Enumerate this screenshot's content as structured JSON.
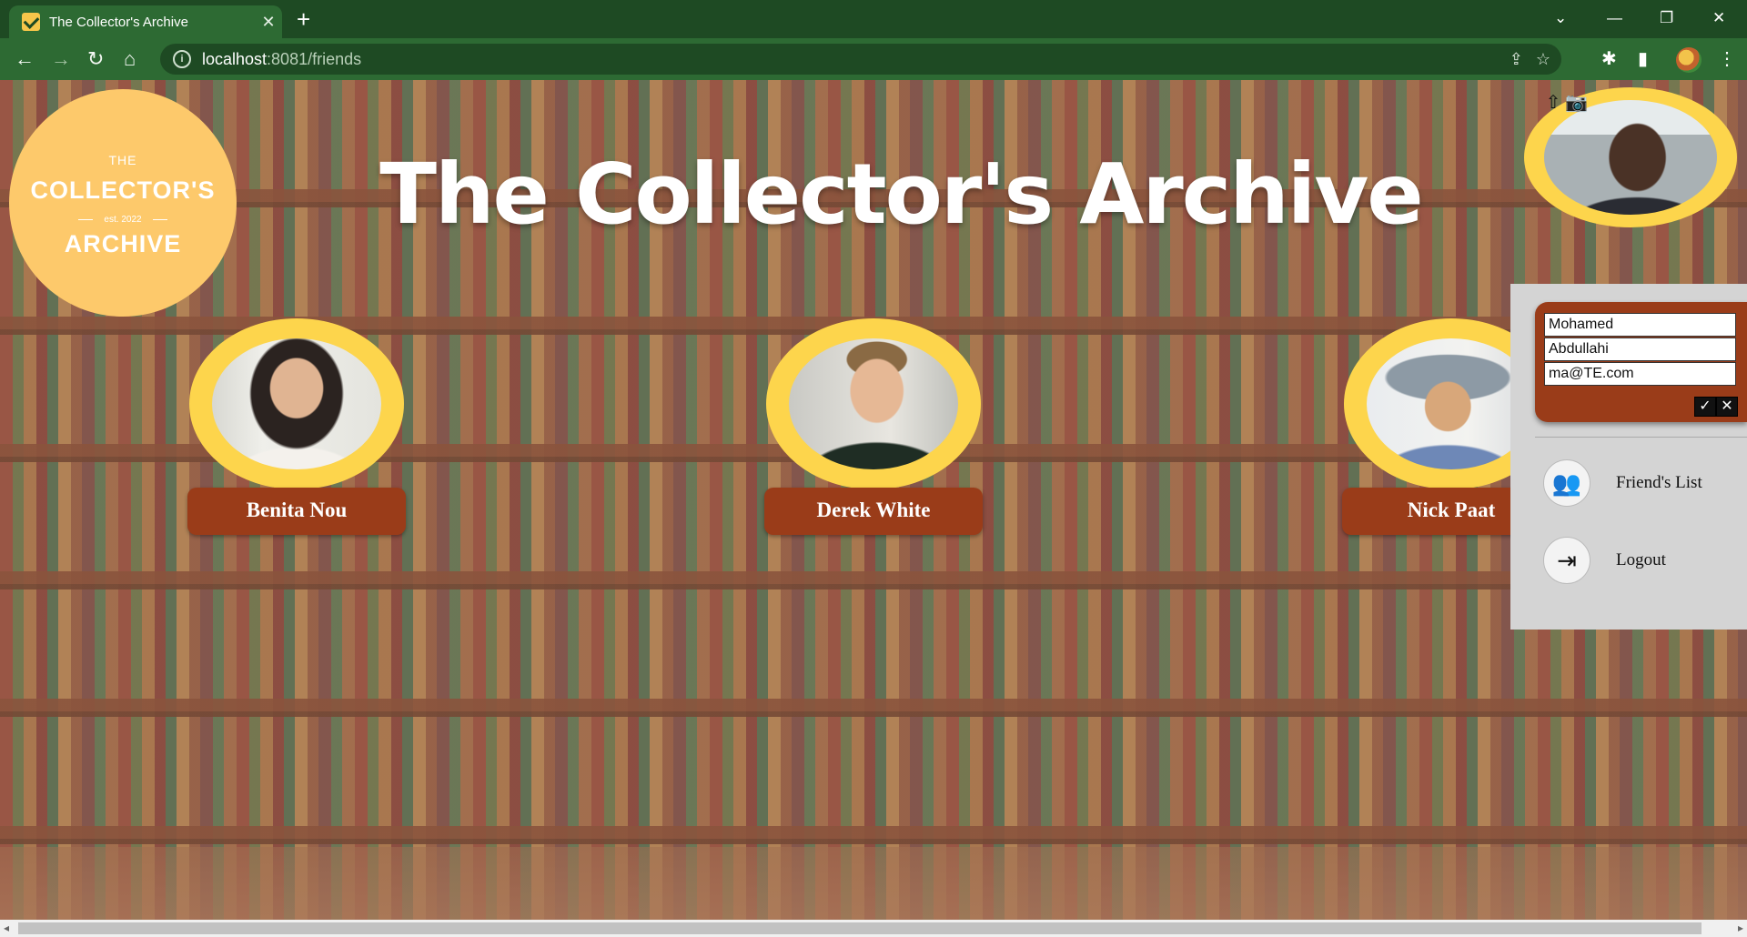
{
  "browser": {
    "tab_title": "The Collector's Archive",
    "tab_close": "✕",
    "new_tab": "+",
    "url_host": "localhost",
    "url_rest": ":8081/friends",
    "window": {
      "dropdown": "⌄",
      "minimize": "—",
      "restore": "❐",
      "close": "✕"
    },
    "nav": {
      "back": "←",
      "forward": "→",
      "reload": "↻",
      "home": "⌂"
    },
    "actions": {
      "share": "⇪",
      "bookmark": "☆",
      "extensions": "✱",
      "sidepanel": "▮",
      "menu": "⋮"
    }
  },
  "logo": {
    "line_the": "THE",
    "line_collectors": "COLLECTOR'S",
    "line_est": "est. 2022",
    "line_archive": "ARCHIVE"
  },
  "page_title": "The Collector's Archive",
  "friends": [
    {
      "name": "Benita Nou"
    },
    {
      "name": "Derek White"
    },
    {
      "name": "Nick Paat"
    }
  ],
  "profile": {
    "upload_icon": "⇧",
    "camera_icon": "📷"
  },
  "edit_form": {
    "first_name": "Mohamed",
    "last_name": "Abdullahi",
    "email": "ma@TE.com",
    "confirm": "✓",
    "cancel": "✕"
  },
  "menu": {
    "friends_label": "Friend's List",
    "friends_icon": "👥",
    "logout_label": "Logout",
    "logout_icon": "⇥"
  },
  "scrollbar": {
    "left": "◂",
    "right": "▸"
  }
}
